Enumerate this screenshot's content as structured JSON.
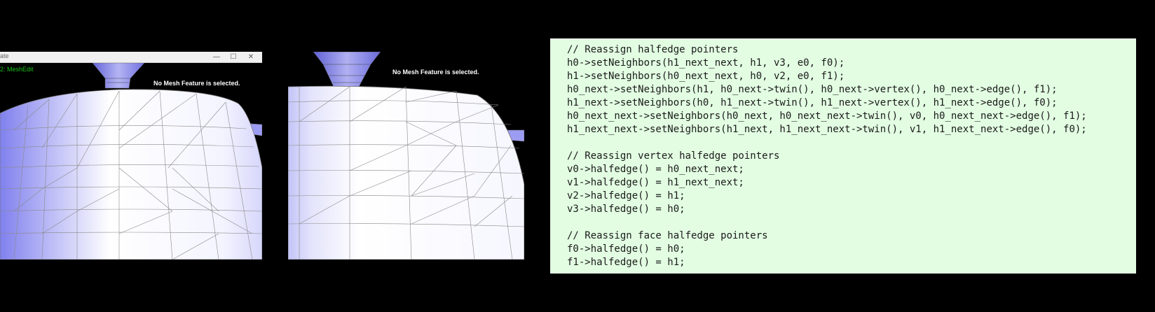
{
  "window1": {
    "title": "ate",
    "mode_label": "2: MeshEdit",
    "status_message": "No Mesh Feature is selected.",
    "controls": {
      "minimize": "—",
      "maximize": "☐",
      "close": "✕"
    }
  },
  "window2": {
    "status_message": "No Mesh Feature is selected."
  },
  "colors": {
    "mesh_face": "#ffffff",
    "mesh_shade": "#8c8cf0",
    "code_bg": "#e2fde2",
    "mode_text": "#18c218"
  },
  "code": {
    "lines": [
      "// Reassign halfedge pointers",
      "h0->setNeighbors(h1_next_next, h1, v3, e0, f0);",
      "h1->setNeighbors(h0_next_next, h0, v2, e0, f1);",
      "h0_next->setNeighbors(h1, h0_next->twin(), h0_next->vertex(), h0_next->edge(), f1);",
      "h1_next->setNeighbors(h0, h1_next->twin(), h1_next->vertex(), h1_next->edge(), f0);",
      "h0_next_next->setNeighbors(h0_next, h0_next_next->twin(), v0, h0_next_next->edge(), f1);",
      "h1_next_next->setNeighbors(h1_next, h1_next_next->twin(), v1, h1_next_next->edge(), f0);",
      "",
      "// Reassign vertex halfedge pointers",
      "v0->halfedge() = h0_next_next;",
      "v1->halfedge() = h1_next_next;",
      "v2->halfedge() = h1;",
      "v3->halfedge() = h0;",
      "",
      "// Reassign face halfedge pointers",
      "f0->halfedge() = h0;",
      "f1->halfedge() = h1;"
    ]
  }
}
